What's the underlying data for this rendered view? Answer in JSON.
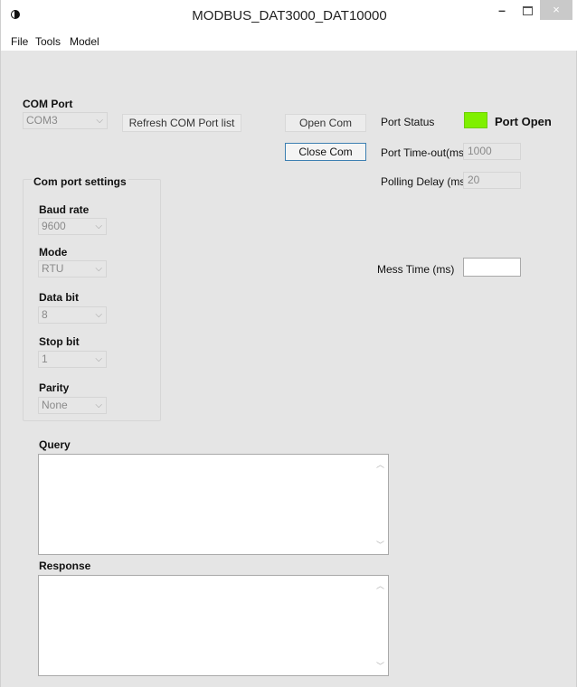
{
  "window": {
    "title": "MODBUS_DAT3000_DAT10000",
    "minimize": "–",
    "close": "×"
  },
  "menu": [
    "File",
    "Tools",
    "Model"
  ],
  "com_port": {
    "label": "COM Port",
    "value": "COM3",
    "refresh_button": "Refresh COM Port list",
    "open_button": "Open Com",
    "close_button": "Close Com"
  },
  "status": {
    "port_status_label": "Port Status",
    "port_status_value": "Port Open",
    "led_color": "#7ff000",
    "timeout_label": "Port Time-out(ms)",
    "timeout_value": "1000",
    "polling_label": "Polling Delay (ms)",
    "polling_value": "20",
    "mess_time_label": "Mess Time (ms)",
    "mess_time_value": ""
  },
  "settings": {
    "title": "Com port settings",
    "baud_label": "Baud rate",
    "baud_value": "9600",
    "mode_label": "Mode",
    "mode_value": "RTU",
    "databit_label": "Data bit",
    "databit_value": "8",
    "stopbit_label": "Stop bit",
    "stopbit_value": "1",
    "parity_label": "Parity",
    "parity_value": "None"
  },
  "query": {
    "label": "Query",
    "text": ""
  },
  "response": {
    "label": "Response",
    "text": ""
  }
}
